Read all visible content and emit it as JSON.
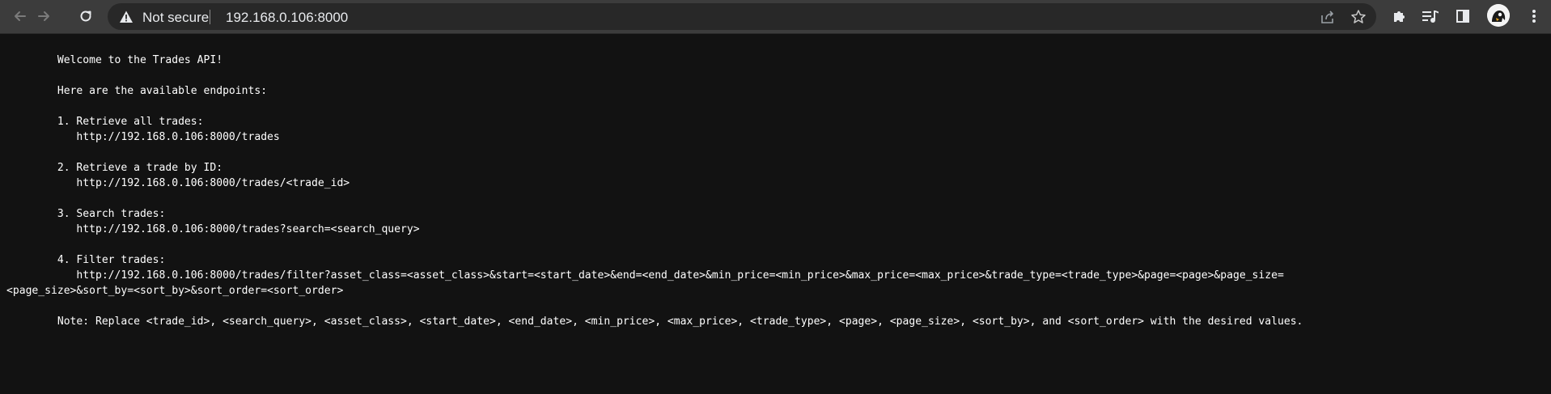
{
  "browser": {
    "security_label": "Not secure",
    "url": "192.168.0.106:8000",
    "icons": {
      "back": "back-arrow-icon",
      "forward": "forward-arrow-icon",
      "reload": "reload-icon",
      "warning": "warning-icon",
      "share": "share-icon",
      "bookmark": "star-icon",
      "extensions": "puzzle-icon",
      "media": "media-playlist-icon",
      "side_panel": "side-panel-icon",
      "menu": "kebab-menu-icon"
    }
  },
  "page": {
    "lines": [
      "",
      "        Welcome to the Trades API!",
      "",
      "        Here are the available endpoints:",
      "",
      "        1. Retrieve all trades:",
      "           http://192.168.0.106:8000/trades",
      "",
      "        2. Retrieve a trade by ID:",
      "           http://192.168.0.106:8000/trades/<trade_id>",
      "",
      "        3. Search trades:",
      "           http://192.168.0.106:8000/trades?search=<search_query>",
      "",
      "        4. Filter trades:",
      "           http://192.168.0.106:8000/trades/filter?asset_class=<asset_class>&start=<start_date>&end=<end_date>&min_price=<min_price>&max_price=<max_price>&trade_type=<trade_type>&page=<page>&page_size=",
      "<page_size>&sort_by=<sort_by>&sort_order=<sort_order>",
      "",
      "        Note: Replace <trade_id>, <search_query>, <asset_class>, <start_date>, <end_date>, <min_price>, <max_price>, <trade_type>, <page>, <page_size>, <sort_by>, and <sort_order> with the desired values."
    ]
  }
}
